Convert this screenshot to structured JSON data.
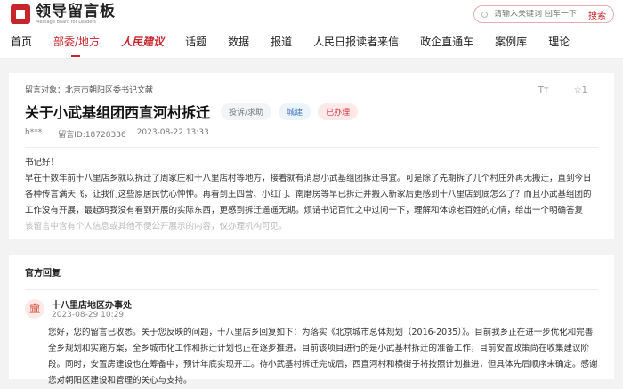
{
  "header": {
    "logo_title": "领导留言板",
    "logo_subtitle": "Message Board for Leaders",
    "search_placeholder": "请输入关键词 回车一下",
    "search_button": "搜索"
  },
  "nav": [
    "首页",
    "部委/地方",
    "人民建议",
    "话题",
    "数据",
    "报道",
    "人民日报读者来信",
    "政企直通车",
    "案例库",
    "理论"
  ],
  "message": {
    "target": "留言对象：北京市朝阳区委书记文献",
    "font_tool": "Tт",
    "favorite": "☆1",
    "title": "关于小武基组团西直河村拆迁",
    "tags": [
      "投诉/求助",
      "城建",
      "已办理"
    ],
    "author": "h***",
    "id": "留言ID:18728336",
    "date": "2023-08-22 13:33",
    "greeting": "书记好！",
    "body": "早在十数年前十八里店乡就以拆迁了周家庄和十八里店村等地方，接着就有消息小武基组团拆迁事宜。可是除了先期拆了几个村庄外再无搬迁，直到今日各种传言满天飞，让我们这些原居民忧心忡忡。再看到王四营、小红门、南磨房等早已拆迁并搬入新家后更感到十八里店到底怎么了？而且小武基组团的工作没有开展，最起码我没有看到开展的实际东西，更感到拆迁遥遥无期。烦请书记百忙之中过问一下，理解和体谅老百姓的心情，给出一个明确答复",
    "privacy_note": "该留言中含有个人信息或其他不便公开展示的内容，仅办理机构可见。"
  },
  "reply": {
    "heading": "官方回复",
    "org": "十八里店地区办事处",
    "date": "2023-08-29 10:29",
    "text": "您好，您的留言已收悉。关于您反映的问题，十八里店乡回复如下：为落实《北京城市总体规划（2016-2035）》。目前我乡正在进一步优化和完善全乡规划和实施方案，全乡城市化工作和拆迁计划也正在逐步推进。目前该项目进行的是小武基村拆迁的准备工作，目前安置政策尚在收集建议阶段。同时，安置房建设也在筹备中，预计年底实现开工。待小武基村拆迁完成后，西直河村和横街子将按照计划推进，但具体先后顺序未确定。感谢您对朝阳区建设和管理的关心与支持。"
  }
}
